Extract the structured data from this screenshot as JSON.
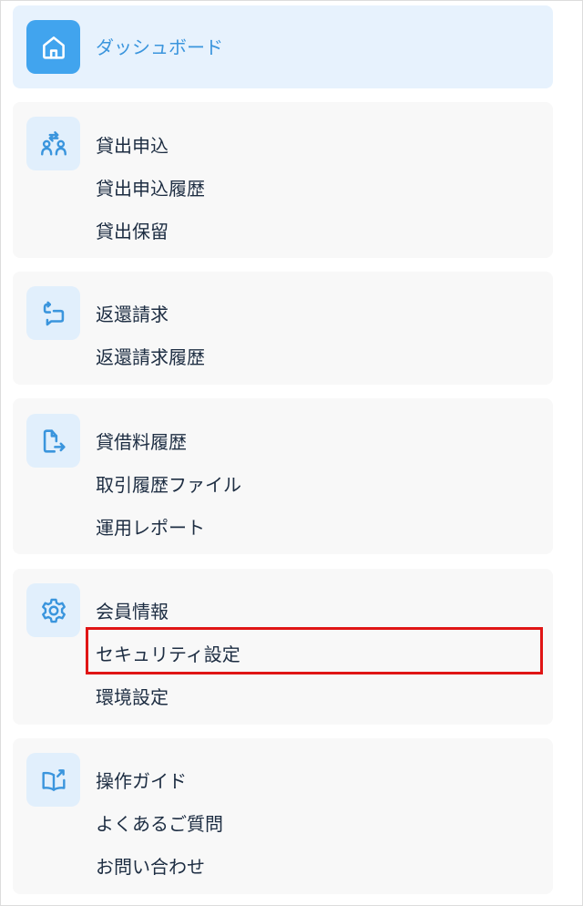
{
  "colors": {
    "accent": "#41a4ee",
    "accent_text": "#3a95dd",
    "icon_bg": "#e1effc",
    "card_bg": "#f8f8f8",
    "active_bg": "#e7f2fd",
    "text": "#1d2d42",
    "highlight": "#e01515"
  },
  "menu": {
    "dashboard": {
      "icon": "home-icon",
      "label": "ダッシュボード"
    },
    "lending": {
      "icon": "lending-exchange-icon",
      "items": [
        "貸出申込",
        "貸出申込履歴",
        "貸出保留"
      ]
    },
    "return": {
      "icon": "return-request-icon",
      "items": [
        "返還請求",
        "返還請求履歴"
      ]
    },
    "history": {
      "icon": "file-export-icon",
      "items": [
        "貸借料履歴",
        "取引履歴ファイル",
        "運用レポート"
      ]
    },
    "settings": {
      "icon": "gear-icon",
      "items": [
        "会員情報",
        "セキュリティ設定",
        "環境設定"
      ]
    },
    "guide": {
      "icon": "open-book-icon",
      "items": [
        "操作ガイド",
        "よくあるご質問",
        "お問い合わせ"
      ]
    }
  },
  "highlighted_item": "セキュリティ設定"
}
